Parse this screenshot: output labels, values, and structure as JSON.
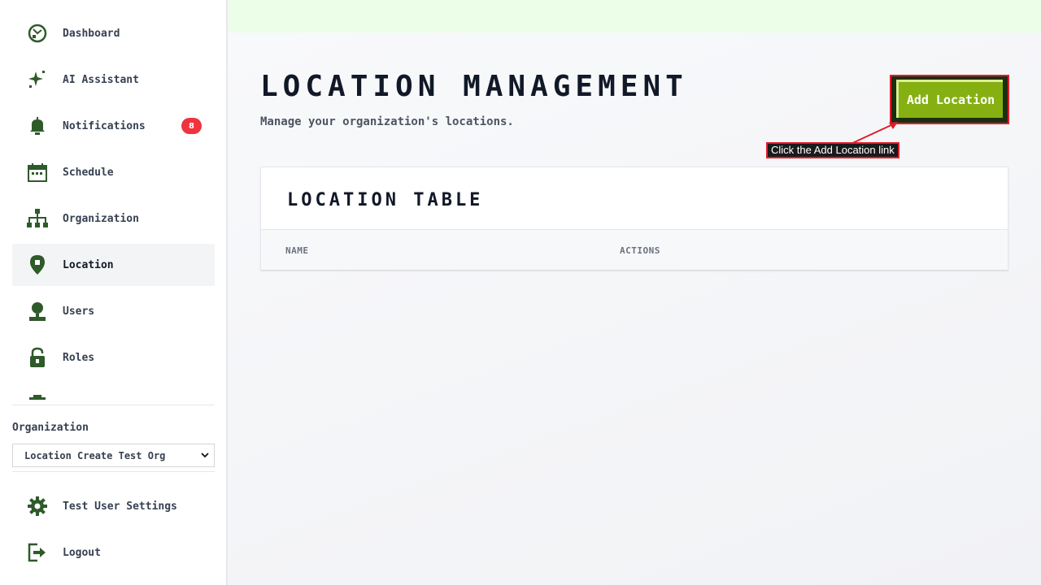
{
  "sidebar": {
    "items": [
      {
        "label": "Dashboard",
        "icon": "dashboard-icon"
      },
      {
        "label": "AI Assistant",
        "icon": "sparkle-icon"
      },
      {
        "label": "Notifications",
        "icon": "bell-icon",
        "badge": "8"
      },
      {
        "label": "Schedule",
        "icon": "calendar-icon"
      },
      {
        "label": "Organization",
        "icon": "org-chart-icon"
      },
      {
        "label": "Location",
        "icon": "location-pin-icon",
        "active": true
      },
      {
        "label": "Users",
        "icon": "user-icon"
      },
      {
        "label": "Roles",
        "icon": "lock-icon"
      }
    ],
    "organization_label": "Organization",
    "organization_selected": "Location Create Test Org",
    "bottom_items": [
      {
        "label": "Test User Settings",
        "icon": "gear-icon"
      },
      {
        "label": "Logout",
        "icon": "logout-icon"
      }
    ]
  },
  "main": {
    "title": "LOCATION MANAGEMENT",
    "subtitle": "Manage your organization's locations.",
    "add_button_label": "Add Location",
    "annotation": "Click the Add Location link",
    "table": {
      "title": "LOCATION TABLE",
      "columns": [
        "NAME",
        "ACTIONS"
      ]
    }
  },
  "colors": {
    "accent": "#86b011",
    "icon": "#2f5a2a",
    "badge": "#ef3340",
    "annotation_border": "#e11d2a"
  }
}
